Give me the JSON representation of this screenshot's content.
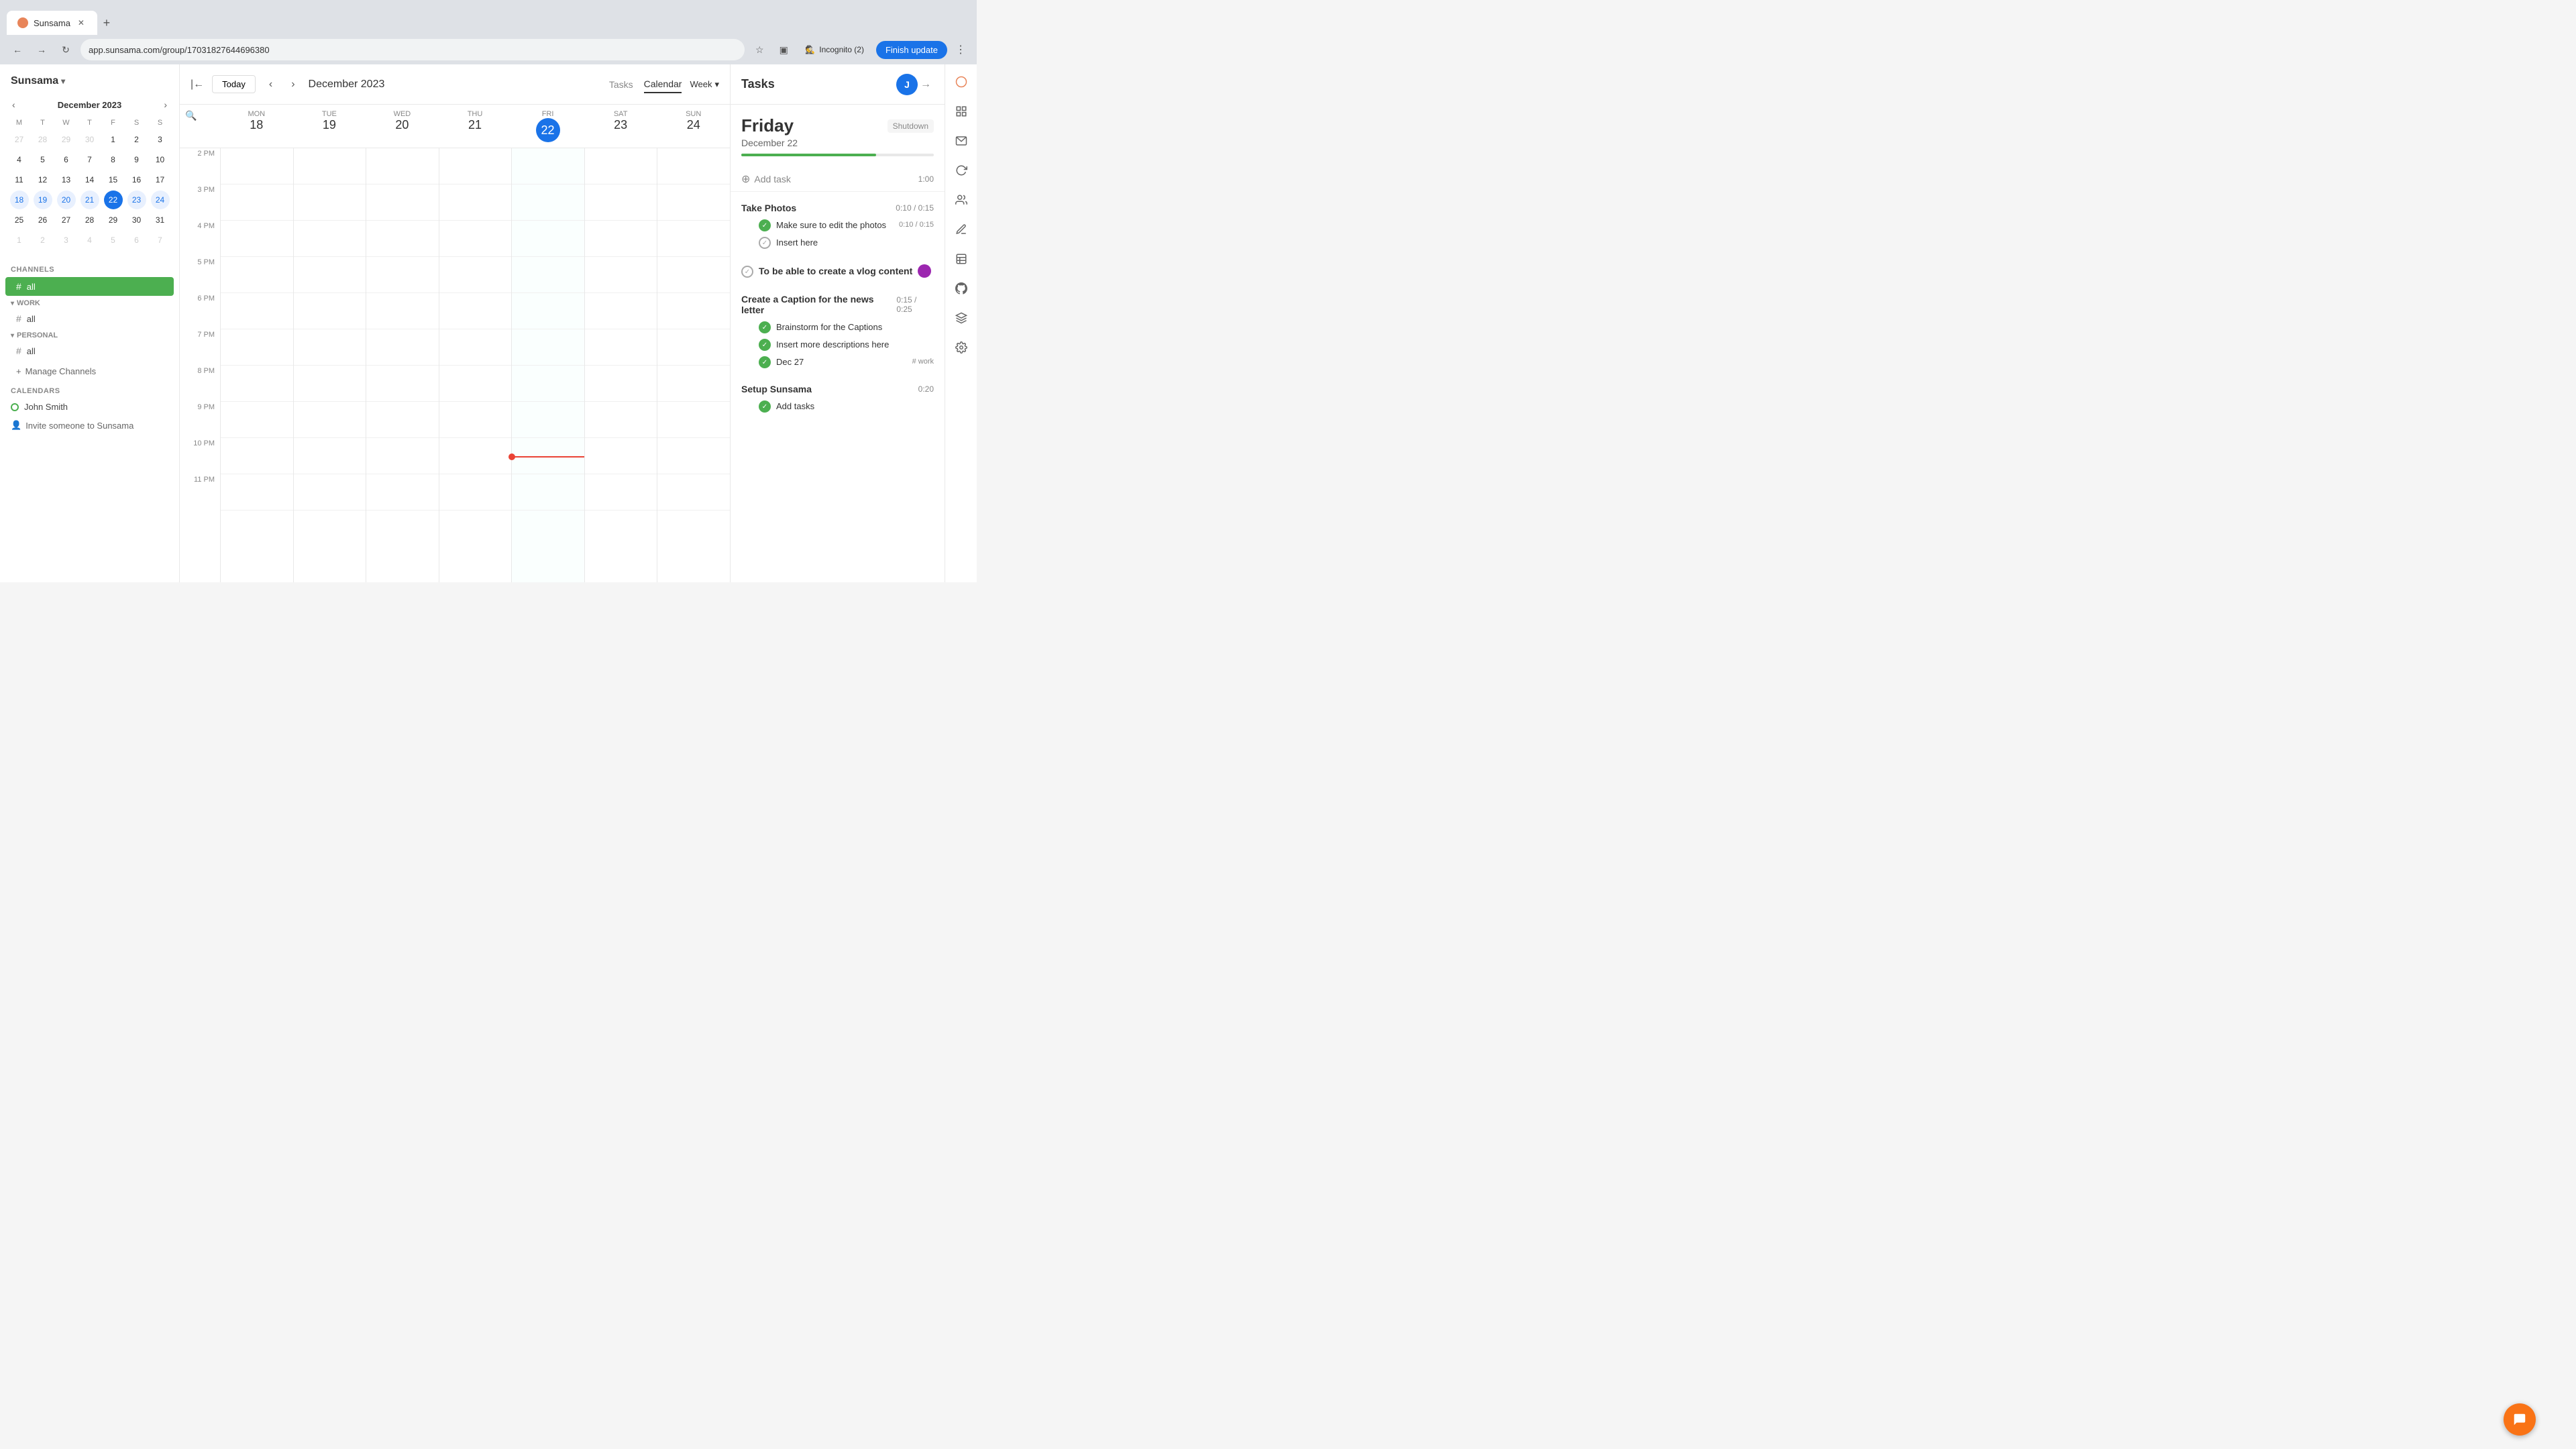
{
  "browser": {
    "tab_title": "Sunsama",
    "tab_url": "app.sunsama.com/group/17031827644696380",
    "new_tab_icon": "+",
    "back_icon": "←",
    "forward_icon": "→",
    "refresh_icon": "↻",
    "incognito_label": "Incognito (2)",
    "finish_update_label": "Finish update",
    "three_dot": "⋮"
  },
  "sidebar": {
    "app_title": "Sunsama",
    "channels_label": "CHANNELS",
    "all_channel": "all",
    "work_group": "WORK",
    "work_all": "all",
    "personal_group": "PERSONAL",
    "personal_all": "all",
    "manage_channels": "Manage Channels",
    "calendars_label": "CALENDARS",
    "calendar_user": "John Smith",
    "invite_label": "Invite someone to Sunsama"
  },
  "mini_calendar": {
    "title": "December 2023",
    "day_headers": [
      "M",
      "T",
      "W",
      "T",
      "F",
      "S",
      "S"
    ],
    "weeks": [
      [
        {
          "d": "27",
          "other": true
        },
        {
          "d": "28",
          "other": true
        },
        {
          "d": "29",
          "other": true
        },
        {
          "d": "30",
          "other": true
        },
        {
          "d": "1"
        },
        {
          "d": "2"
        },
        {
          "d": "3"
        }
      ],
      [
        {
          "d": "4"
        },
        {
          "d": "5"
        },
        {
          "d": "6"
        },
        {
          "d": "7"
        },
        {
          "d": "8"
        },
        {
          "d": "9"
        },
        {
          "d": "10"
        }
      ],
      [
        {
          "d": "11"
        },
        {
          "d": "12"
        },
        {
          "d": "13"
        },
        {
          "d": "14"
        },
        {
          "d": "15"
        },
        {
          "d": "16"
        },
        {
          "d": "17"
        }
      ],
      [
        {
          "d": "18",
          "week": true
        },
        {
          "d": "19",
          "week": true
        },
        {
          "d": "20",
          "week": true
        },
        {
          "d": "21",
          "week": true
        },
        {
          "d": "22",
          "today": true
        },
        {
          "d": "23",
          "week": true
        },
        {
          "d": "24",
          "week": true
        }
      ],
      [
        {
          "d": "25"
        },
        {
          "d": "26"
        },
        {
          "d": "27"
        },
        {
          "d": "28"
        },
        {
          "d": "29"
        },
        {
          "d": "30"
        },
        {
          "d": "31"
        }
      ],
      [
        {
          "d": "1",
          "other": true
        },
        {
          "d": "2",
          "other": true
        },
        {
          "d": "3",
          "other": true
        },
        {
          "d": "4",
          "other": true
        },
        {
          "d": "5",
          "other": true
        },
        {
          "d": "6",
          "other": true
        },
        {
          "d": "7",
          "other": true
        }
      ]
    ]
  },
  "calendar": {
    "today_label": "Today",
    "month_title": "December 2023",
    "view_tasks": "Tasks",
    "view_calendar": "Calendar",
    "view_week": "Week",
    "days": [
      {
        "name": "MON",
        "num": "18"
      },
      {
        "name": "TUE",
        "num": "19"
      },
      {
        "name": "WED",
        "num": "20"
      },
      {
        "name": "THU",
        "num": "21"
      },
      {
        "name": "FRI",
        "num": "22",
        "today": true
      },
      {
        "name": "SAT",
        "num": "23"
      },
      {
        "name": "SUN",
        "num": "24"
      }
    ],
    "time_slots": [
      "2 PM",
      "3 PM",
      "4 PM",
      "5 PM",
      "6 PM",
      "7 PM",
      "8 PM",
      "9 PM",
      "10 PM",
      "11 PM"
    ]
  },
  "tasks_panel": {
    "title": "Tasks",
    "avatar_initial": "J",
    "day_name": "Friday",
    "day_date": "December 22",
    "shutdown_label": "Shutdown",
    "progress_pct": 70,
    "add_task_label": "Add task",
    "add_task_time": "1:00",
    "task_groups": [
      {
        "title": "Take Photos",
        "time": "0:10 / 0:15",
        "subtasks": [
          {
            "text": "Make sure to edit the photos",
            "time": "0:10 / 0:15",
            "checked": true
          },
          {
            "text": "Insert here",
            "checked": false
          }
        ]
      },
      {
        "title": "To be able to create a vlog content",
        "has_avatar": true,
        "subtasks": []
      },
      {
        "title": "Create a Caption for the news letter",
        "time": "0:15 / 0:25",
        "subtasks": [
          {
            "text": "Brainstorm for the Captions",
            "checked": true
          },
          {
            "text": "Insert more descriptions here",
            "checked": true
          },
          {
            "text": "Dec 27",
            "tag": "work",
            "checked": true
          }
        ]
      },
      {
        "title": "Setup Sunsama",
        "time": "0:20",
        "subtasks": [
          {
            "text": "Add tasks",
            "checked": true,
            "green": true
          }
        ]
      }
    ]
  },
  "right_icons": [
    "notification",
    "grid",
    "mail",
    "refresh",
    "people",
    "pen",
    "table",
    "settings",
    "github",
    "layers",
    "chat"
  ]
}
